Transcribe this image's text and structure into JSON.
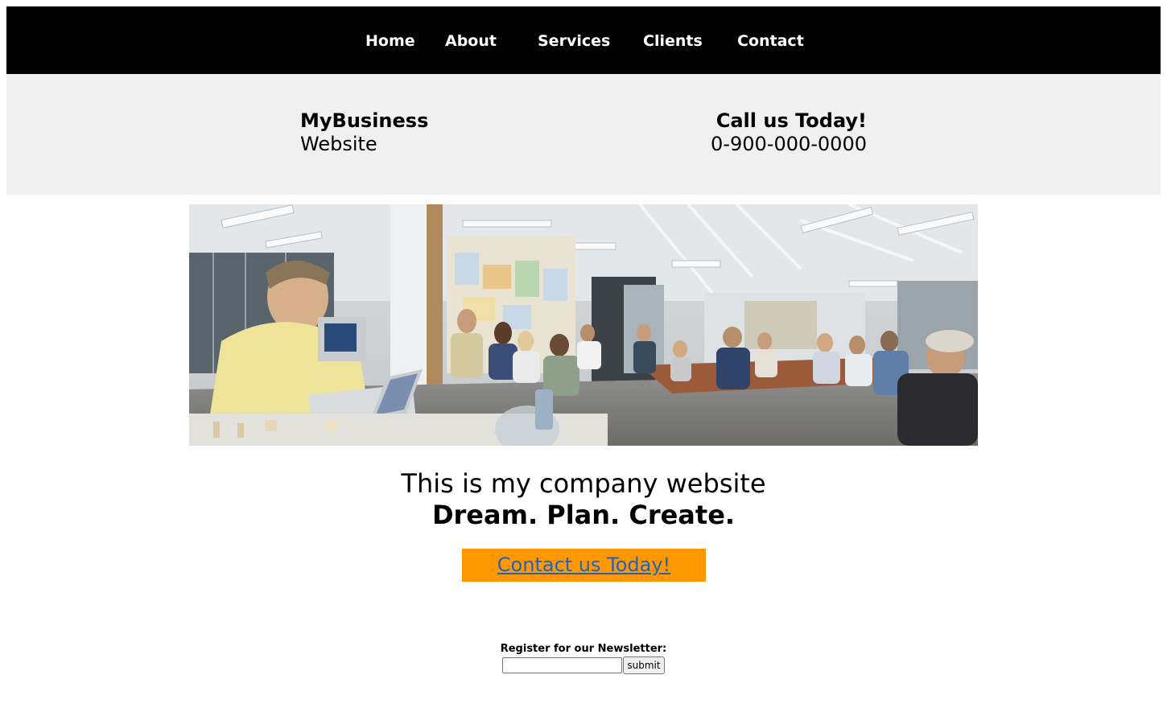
{
  "nav": {
    "items": [
      {
        "label": "Home"
      },
      {
        "label": "About"
      },
      {
        "label": "Services"
      },
      {
        "label": "Clients"
      },
      {
        "label": "Contact"
      }
    ]
  },
  "header": {
    "brand_name": "MyBusiness",
    "brand_sub": "Website",
    "call_title": "Call us Today!",
    "phone": "0-900-000-0000"
  },
  "hero": {
    "image_subject": "office-meeting-photo"
  },
  "tagline": {
    "line1": "This is my company website",
    "line2": "Dream. Plan. Create."
  },
  "cta": {
    "label": "Contact us Today!",
    "background": "#ff9800",
    "link_color": "#1f63c0"
  },
  "newsletter": {
    "label": "Register for our Newsletter:",
    "input_value": "",
    "submit_label": "submit"
  },
  "colors": {
    "nav_bg": "#000000",
    "header_band_bg": "#f0f0f0"
  }
}
